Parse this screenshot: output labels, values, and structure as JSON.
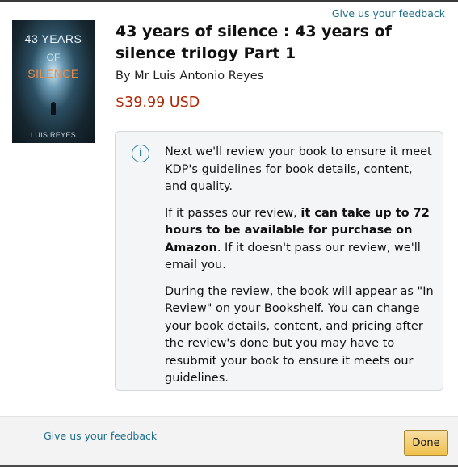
{
  "top_feedback_link": "Give us your feedback",
  "cover": {
    "title_line1": "43 YEARS",
    "title_line2": "OF",
    "title_line3": "SILENCE",
    "author": "LUIS REYES"
  },
  "book": {
    "title": "43 years of silence : 43 years of silence trilogy Part 1",
    "author": "By Mr Luis Antonio Reyes",
    "price": "$39.99 USD"
  },
  "info": {
    "icon": "info-icon",
    "icon_glyph": "i",
    "p1": "Next we'll review your book to ensure it meet KDP's guidelines for book details, content, and quality.",
    "p2_before": "If it passes our review, ",
    "p2_bold": "it can take up to 72 hours to be available for purchase on Amazon",
    "p2_after": ". If it doesn't pass our review, we'll email you.",
    "p3": "During the review, the book will appear as \"In Review\" on your Bookshelf. You can change your book details, content, and pricing after the review's done but you may have to resubmit your book to ensure it meets our guidelines."
  },
  "footer": {
    "feedback_link": "Give us your feedback",
    "done_label": "Done"
  },
  "colors": {
    "link": "#1f6f8b",
    "price": "#b12704",
    "button": "#f0c14b"
  }
}
